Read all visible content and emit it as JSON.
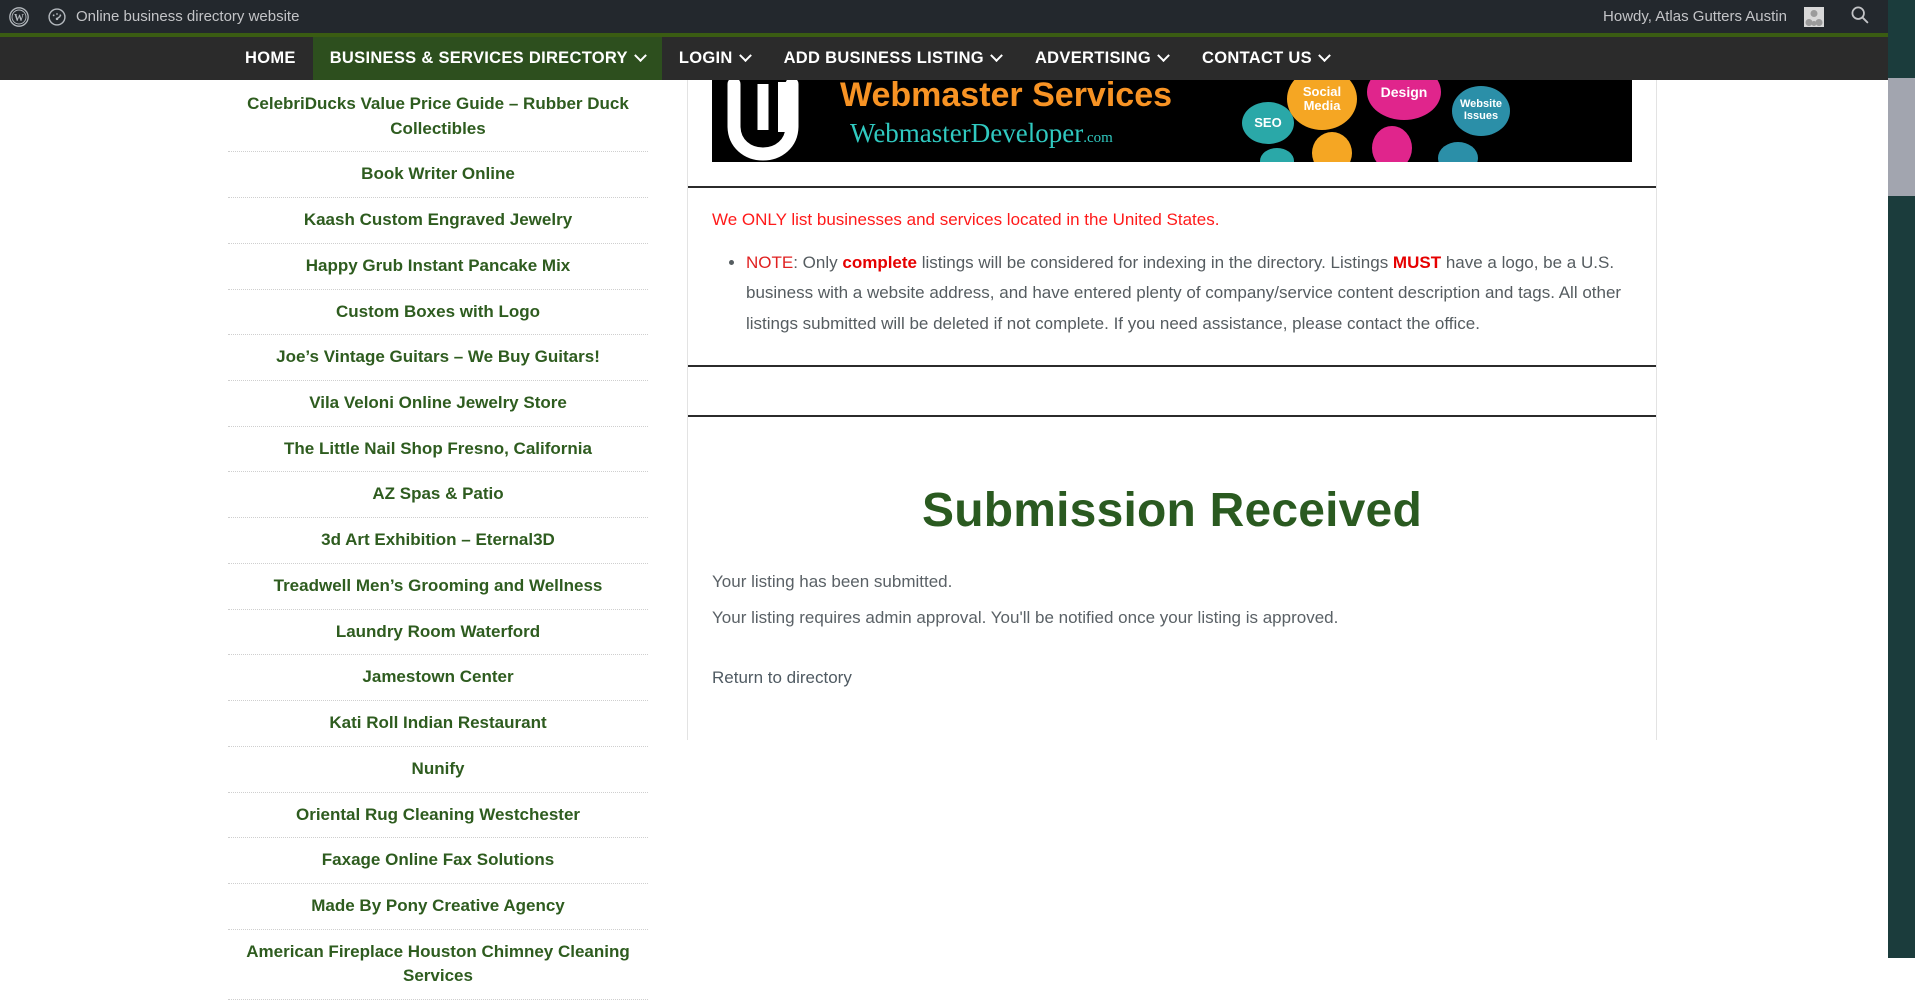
{
  "adminbar": {
    "wp_logo_icon": "wordpress-logo-icon",
    "dashboard_icon": "dashboard-speedometer-icon",
    "site_name": "Online business directory website",
    "howdy": "Howdy, Atlas Gutters Austin",
    "avatar_icon": "user-avatar-icon",
    "search_icon": "search-icon"
  },
  "nav": {
    "items": [
      {
        "label": "HOME",
        "has_caret": false,
        "active": false
      },
      {
        "label": "BUSINESS & SERVICES DIRECTORY",
        "has_caret": true,
        "active": true
      },
      {
        "label": "LOGIN",
        "has_caret": true,
        "active": false
      },
      {
        "label": "ADD BUSINESS LISTING",
        "has_caret": true,
        "active": false
      },
      {
        "label": "ADVERTISING",
        "has_caret": true,
        "active": false
      },
      {
        "label": "CONTACT US",
        "has_caret": true,
        "active": false
      }
    ]
  },
  "sidebar": {
    "items": [
      {
        "label": "CelebriDucks Value Price Guide – Rubber Duck Collectibles"
      },
      {
        "label": "Book Writer Online"
      },
      {
        "label": "Kaash Custom Engraved Jewelry"
      },
      {
        "label": "Happy Grub Instant Pancake Mix"
      },
      {
        "label": "Custom Boxes with Logo"
      },
      {
        "label": "Joe’s Vintage Guitars – We Buy Guitars!"
      },
      {
        "label": "Vila Veloni Online Jewelry Store"
      },
      {
        "label": "The Little Nail Shop Fresno, California"
      },
      {
        "label": "AZ Spas & Patio"
      },
      {
        "label": "3d Art Exhibition – Eternal3D"
      },
      {
        "label": "Treadwell Men’s Grooming and Wellness"
      },
      {
        "label": "Laundry Room Waterford"
      },
      {
        "label": "Jamestown Center"
      },
      {
        "label": "Kati Roll Indian Restaurant"
      },
      {
        "label": "Nunify"
      },
      {
        "label": "Oriental Rug Cleaning Westchester"
      },
      {
        "label": "Faxage Online Fax Solutions"
      },
      {
        "label": "Made By Pony Creative Agency"
      },
      {
        "label": "American Fireplace Houston Chimney Cleaning Services"
      }
    ]
  },
  "banner": {
    "title": "Webmaster Services",
    "subtitle": "WebmasterDeveloper",
    "subtitle_tld": ".com",
    "logo_icon": "webmaster-developer-logo-icon",
    "bubbles": [
      {
        "label": "SEO",
        "color": "#2aa8a8"
      },
      {
        "label": "Social Media",
        "color": "#f5a623"
      },
      {
        "label": "Design",
        "color": "#e0258c"
      },
      {
        "label": "Website Issues",
        "color": "#2b8fa8"
      }
    ],
    "title_color": "#f79324",
    "subtitle_color": "#30c9c0"
  },
  "notice": {
    "us_only": "We ONLY list businesses and services located in the United States.",
    "note_label": "NOTE",
    "note_part1": ": Only ",
    "note_complete": "complete",
    "note_part2": " listings will be considered for indexing in the directory. Listings ",
    "note_must": "MUST",
    "note_part3": " have a logo, be a U.S. business with a website address, and have entered plenty of company/service content description and tags. All other listings submitted will be deleted if not complete. If you need assistance, please contact the office."
  },
  "submission": {
    "heading": "Submission Received",
    "line1": "Your listing has been submitted.",
    "line2": "Your listing requires admin approval. You'll be notified once your listing is approved.",
    "return_link": "Return to directory"
  },
  "colors": {
    "brand_green": "#2d4f1e",
    "heading_green": "#2a5a20",
    "link_green": "#2e5c1f",
    "alert_red": "#ff1a1a",
    "adminbar_bg": "#23282d",
    "nav_bg": "#2b2b2b",
    "scrollbar_track": "#1b3c3c",
    "scrollbar_thumb": "#a2a5af"
  }
}
